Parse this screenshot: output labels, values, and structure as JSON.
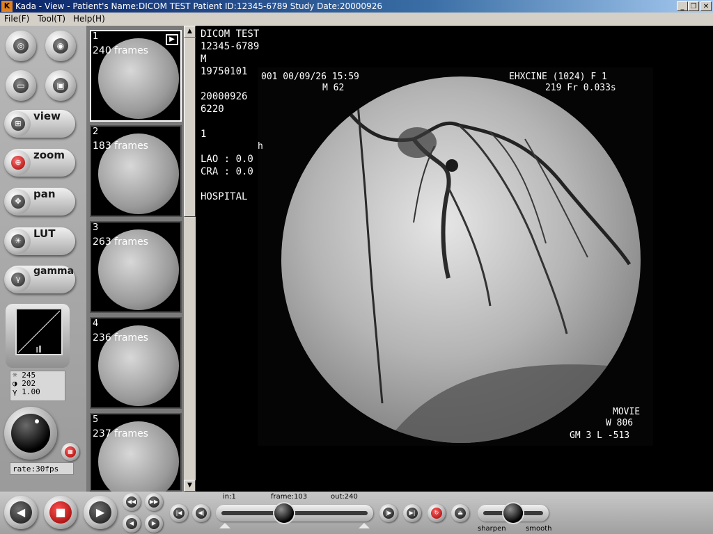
{
  "window": {
    "title": "Kada - View - Patient's Name:DICOM TEST Patient ID:12345-6789 Study Date:20000926",
    "logo_text": "K",
    "minimize": "_",
    "restore": "❐",
    "close": "✕"
  },
  "menu": [
    "File(F)",
    "Tool(T)",
    "Help(H)"
  ],
  "tools": {
    "view_label": "view",
    "zoom_label": "zoom",
    "pan_label": "pan",
    "lut_label": "LUT",
    "gamma_label": "gamma"
  },
  "lut_values": {
    "brightness": "245",
    "contrast": "202",
    "gamma": "1.00",
    "brightness_icon": "☼",
    "contrast_icon": "◑",
    "gamma_icon": "γ"
  },
  "rate": "rate:30fps",
  "thumbnails": [
    {
      "index": "1",
      "frames": "240  frames"
    },
    {
      "index": "2",
      "frames": "183  frames"
    },
    {
      "index": "3",
      "frames": "263  frames"
    },
    {
      "index": "4",
      "frames": "236  frames"
    },
    {
      "index": "5",
      "frames": "237  frames"
    }
  ],
  "patient_info": {
    "name": "DICOM TEST",
    "id": "12345-6789",
    "sex": "M",
    "birth_date": "19750101",
    "study_date": "20000926",
    "study_id": "6220",
    "series": "1",
    "lao": "LAO : 0.0",
    "cra": "CRA : 0.0",
    "institution": "HOSPITAL"
  },
  "image_overlay": {
    "top_left_line1": "001    00/09/26 15:59",
    "top_left_line2": "M 62",
    "top_right_line1": "EHXCINE (1024) F    1",
    "top_right_line2": "219 Fr    0.033s",
    "bottom_right_line1": "MOVIE",
    "bottom_right_line2": "W  806",
    "bottom_right_line3": "GM 3  L -513",
    "side_mark": "h"
  },
  "playback": {
    "in_label": "in:1",
    "frame_label": "frame:103",
    "out_label": "out:240",
    "frame_position": 0.43
  },
  "filter": {
    "sharpen_label": "sharpen",
    "smooth_label": "smooth",
    "level": 0.5
  }
}
